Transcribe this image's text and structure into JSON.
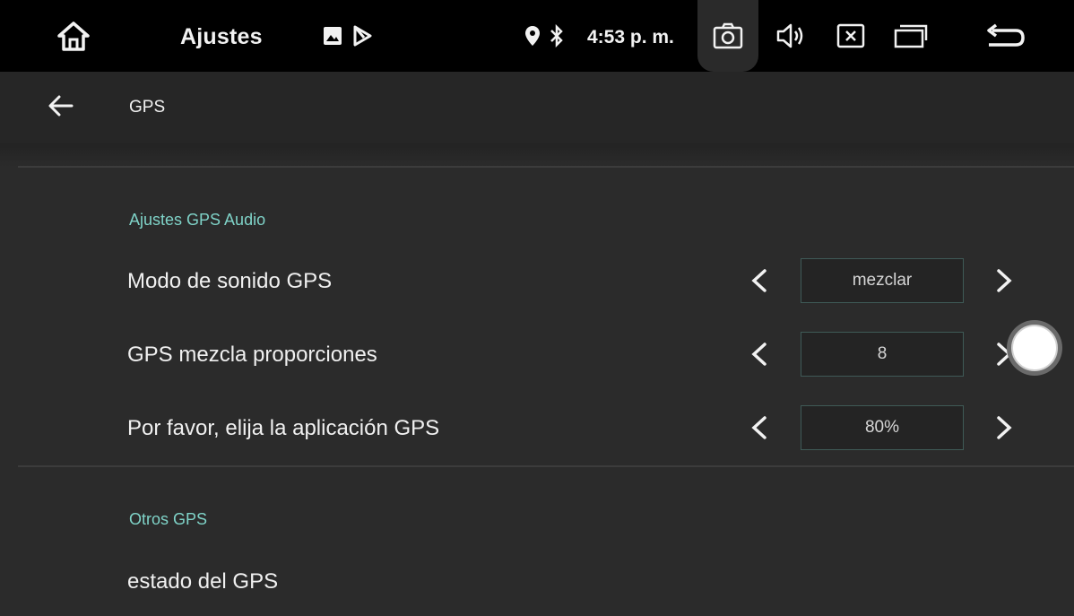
{
  "statusbar": {
    "app_title": "Ajustes",
    "time": "4:53 p. m.",
    "icons": [
      "home-icon",
      "image-icon",
      "play-store-icon",
      "location-icon",
      "bluetooth-icon",
      "camera-icon",
      "volume-icon",
      "close-window-icon",
      "recents-icon",
      "back-return-icon"
    ]
  },
  "toolbar": {
    "title": "GPS",
    "back_icon": "arrow-left-icon"
  },
  "sections": [
    {
      "header": "Ajustes GPS Audio",
      "rows": [
        {
          "label": "Modo de sonido GPS",
          "value": "mezclar"
        },
        {
          "label": "GPS mezcla proporciones",
          "value": "8"
        },
        {
          "label": "Por favor, elija la aplicación GPS",
          "value": "80%"
        }
      ]
    },
    {
      "header": "Otros GPS",
      "rows": [
        {
          "label": "estado del GPS"
        }
      ]
    }
  ],
  "colors": {
    "accent": "#7fd3c8",
    "background": "#2b2b2b",
    "statusbar": "#000000",
    "toolbar": "#262626"
  }
}
